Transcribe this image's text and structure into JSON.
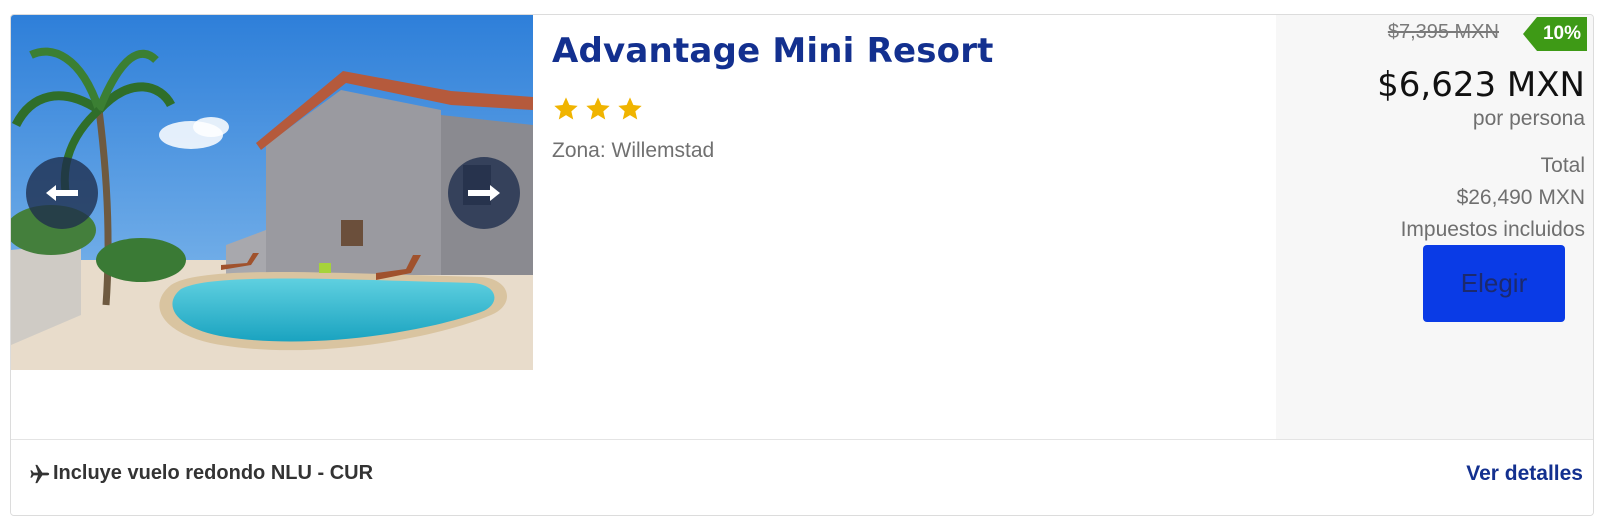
{
  "hotel": {
    "name": "Advantage Mini Resort",
    "star_rating": 3,
    "zone": "Zona: Willemstad"
  },
  "gallery": {
    "prev_icon": "arrow-left-icon",
    "next_icon": "arrow-right-icon"
  },
  "pricing": {
    "old_price": "$7,395 MXN",
    "discount": "10%",
    "price": "$6,623 MXN",
    "per_person": "por persona",
    "total_label": "Total",
    "total_value": "$26,490 MXN",
    "taxes": "Impuestos incluidos",
    "choose_label": "Elegir"
  },
  "footer": {
    "flight_icon": "airplane-icon",
    "flight_text": "Incluye vuelo redondo NLU - CUR",
    "details_label": "Ver detalles"
  },
  "colors": {
    "brand_blue": "#13308f",
    "button_blue": "#0a3be6",
    "discount_green": "#3e9a16",
    "star_gold": "#f0b400"
  }
}
